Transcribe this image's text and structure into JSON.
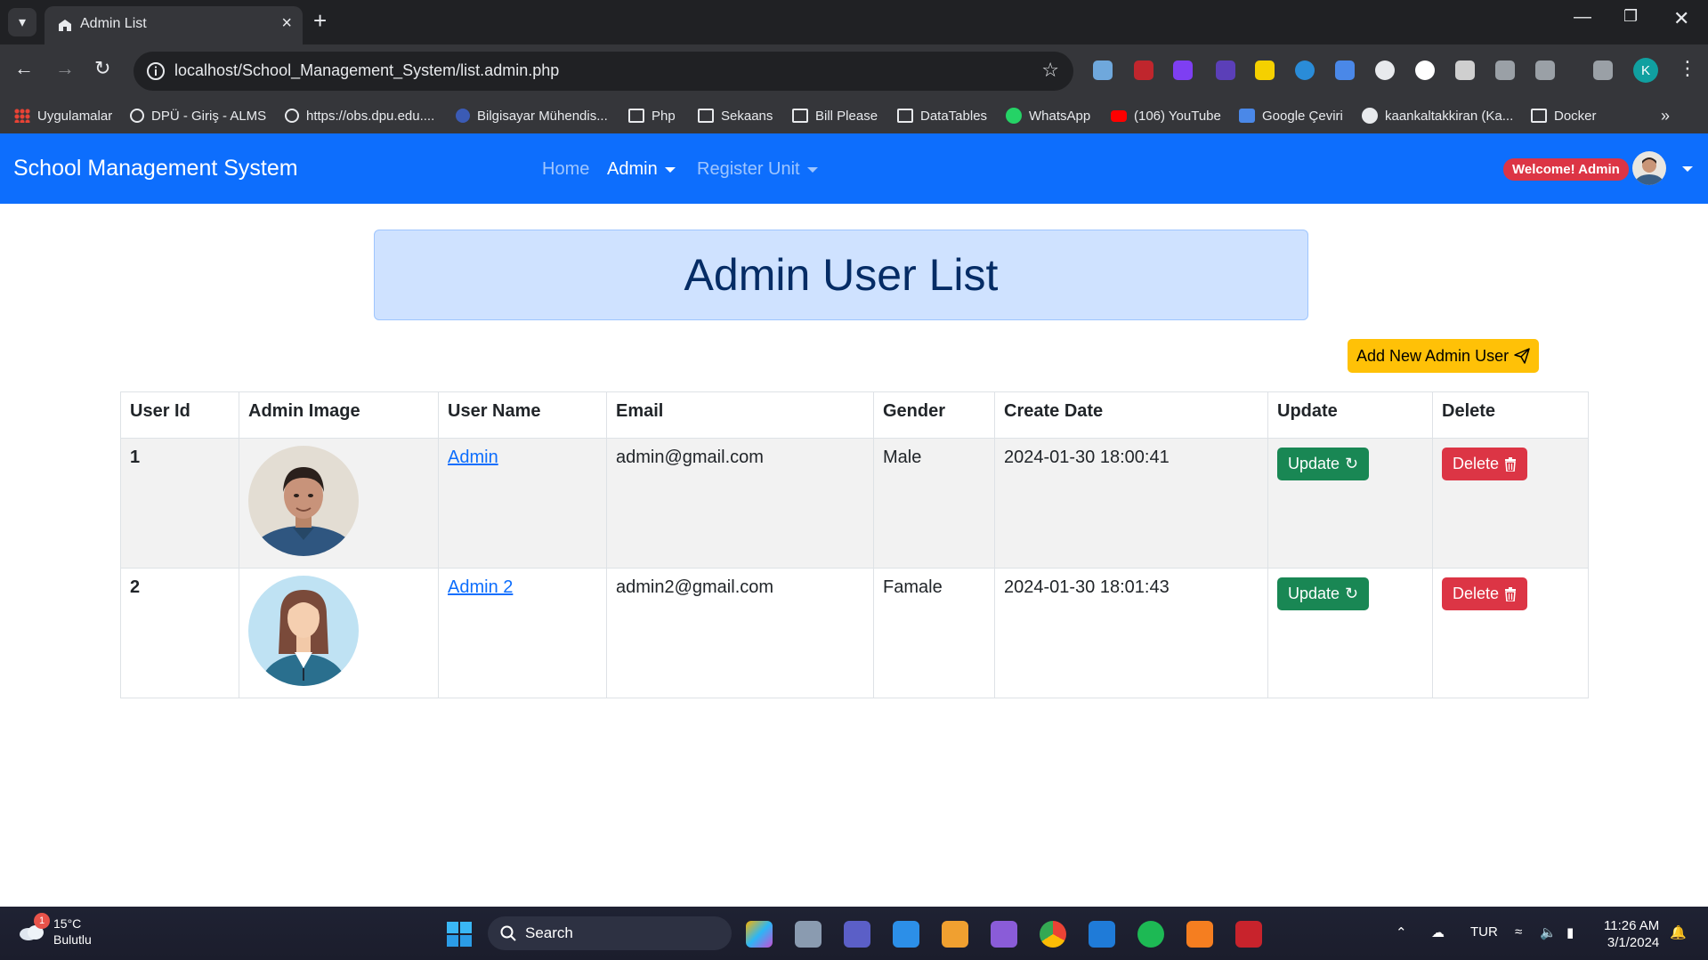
{
  "browser": {
    "tab_title": "Admin List",
    "url": "localhost/School_Management_System/list.admin.php",
    "profile_initial": "K",
    "bookmarks": [
      {
        "label": "Uygulamalar",
        "icon": "apps-grid-icon"
      },
      {
        "label": "DPÜ - Giriş - ALMS",
        "icon": "globe-icon"
      },
      {
        "label": "https://obs.dpu.edu....",
        "icon": "globe-icon"
      },
      {
        "label": "Bilgisayar Mühendis...",
        "icon": "site-icon"
      },
      {
        "label": "Php",
        "icon": "folder-icon"
      },
      {
        "label": "Sekaans",
        "icon": "folder-icon"
      },
      {
        "label": "Bill Please",
        "icon": "folder-icon"
      },
      {
        "label": "DataTables",
        "icon": "folder-icon"
      },
      {
        "label": "WhatsApp",
        "icon": "whatsapp-icon"
      },
      {
        "label": "(106) YouTube",
        "icon": "youtube-icon"
      },
      {
        "label": "Google Çeviri",
        "icon": "google-translate-icon"
      },
      {
        "label": "kaankaltakkiran (Ka...",
        "icon": "github-icon"
      },
      {
        "label": "Docker",
        "icon": "folder-icon"
      }
    ]
  },
  "navbar": {
    "brand": "School Management System",
    "links": [
      "Home",
      "Admin",
      "Register Unit"
    ],
    "welcome": "Welcome! Admin"
  },
  "page": {
    "heading": "Admin User List",
    "add_button": "Add New Admin User"
  },
  "table": {
    "headers": [
      "User Id",
      "Admin Image",
      "User Name",
      "Email",
      "Gender",
      "Create Date",
      "Update",
      "Delete"
    ],
    "rows": [
      {
        "id": "1",
        "name": "Admin",
        "email": "admin@gmail.com",
        "gender": "Male",
        "date": "2024-01-30 18:00:41"
      },
      {
        "id": "2",
        "name": "Admin 2",
        "email": "admin2@gmail.com",
        "gender": "Famale",
        "date": "2024-01-30 18:01:43"
      }
    ],
    "update_label": "Update",
    "delete_label": "Delete"
  },
  "taskbar": {
    "temperature": "15°C",
    "weather": "Bulutlu",
    "weather_badge": "1",
    "search": "Search",
    "language": "TUR",
    "time": "11:26 AM",
    "date": "3/1/2024"
  },
  "colors": {
    "primary": "#0d6efd",
    "success": "#198754",
    "danger": "#dc3545",
    "warning": "#ffc107",
    "alert_bg": "#cfe2ff"
  }
}
